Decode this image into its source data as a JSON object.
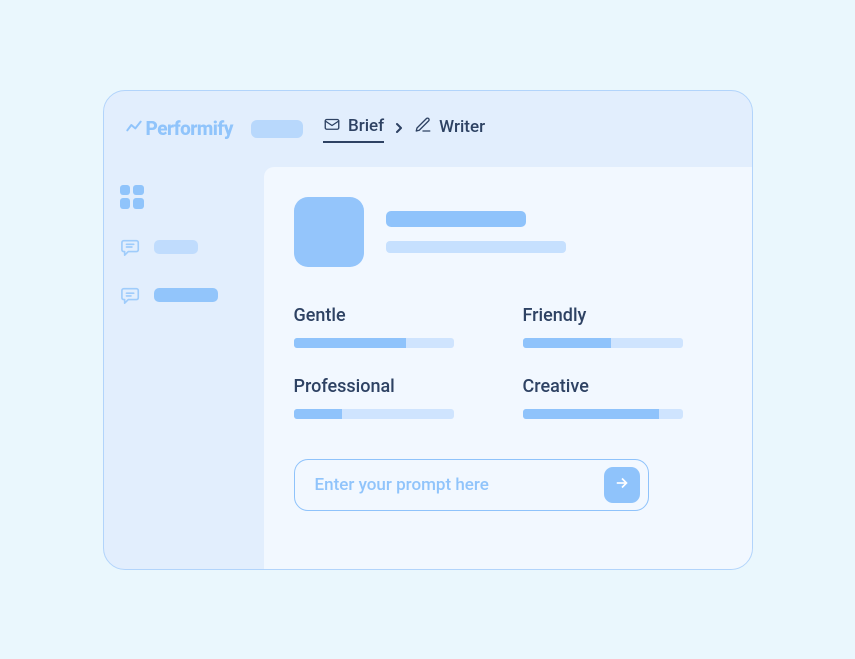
{
  "logo": "Performify",
  "breadcrumb": {
    "brief": "Brief",
    "writer": "Writer"
  },
  "sliders": {
    "gentle": {
      "label": "Gentle",
      "value": 70
    },
    "friendly": {
      "label": "Friendly",
      "value": 55
    },
    "professional": {
      "label": "Professional",
      "value": 30
    },
    "creative": {
      "label": "Creative",
      "value": 85
    }
  },
  "prompt": {
    "placeholder": "Enter your prompt here"
  }
}
